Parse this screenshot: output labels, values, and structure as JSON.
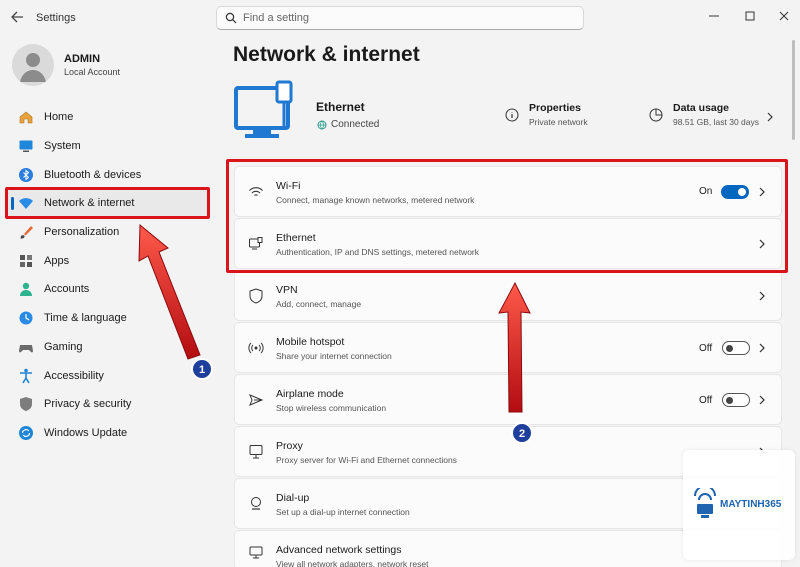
{
  "window": {
    "title": "Settings"
  },
  "search": {
    "placeholder": "Find a setting"
  },
  "user": {
    "name": "ADMIN",
    "account_type": "Local Account"
  },
  "sidebar": {
    "items": [
      {
        "label": "Home",
        "icon": "home-icon"
      },
      {
        "label": "System",
        "icon": "monitor-icon"
      },
      {
        "label": "Bluetooth & devices",
        "icon": "bluetooth-icon"
      },
      {
        "label": "Network & internet",
        "icon": "wifi-icon",
        "active": true
      },
      {
        "label": "Personalization",
        "icon": "brush-icon"
      },
      {
        "label": "Apps",
        "icon": "apps-icon"
      },
      {
        "label": "Accounts",
        "icon": "person-icon"
      },
      {
        "label": "Time & language",
        "icon": "globe-clock-icon"
      },
      {
        "label": "Gaming",
        "icon": "controller-icon"
      },
      {
        "label": "Accessibility",
        "icon": "accessibility-icon"
      },
      {
        "label": "Privacy & security",
        "icon": "shield-icon"
      },
      {
        "label": "Windows Update",
        "icon": "update-icon"
      }
    ]
  },
  "main": {
    "title": "Network & internet",
    "hero": {
      "name": "Ethernet",
      "status": "Connected",
      "properties": {
        "title": "Properties",
        "subtitle": "Private network"
      },
      "data_usage": {
        "title": "Data usage",
        "subtitle": "98.51 GB, last 30 days"
      }
    },
    "cards": [
      {
        "title": "Wi-Fi",
        "desc": "Connect, manage known networks, metered network",
        "toggle": "On",
        "icon": "wifi-icon"
      },
      {
        "title": "Ethernet",
        "desc": "Authentication, IP and DNS settings, metered network",
        "icon": "ethernet-icon"
      },
      {
        "title": "VPN",
        "desc": "Add, connect, manage",
        "icon": "vpn-shield-icon"
      },
      {
        "title": "Mobile hotspot",
        "desc": "Share your internet connection",
        "toggle": "Off",
        "icon": "hotspot-icon"
      },
      {
        "title": "Airplane mode",
        "desc": "Stop wireless communication",
        "toggle": "Off",
        "icon": "airplane-icon"
      },
      {
        "title": "Proxy",
        "desc": "Proxy server for Wi-Fi and Ethernet connections",
        "icon": "proxy-icon"
      },
      {
        "title": "Dial-up",
        "desc": "Set up a dial-up internet connection",
        "icon": "dialup-icon"
      },
      {
        "title": "Advanced network settings",
        "desc": "View all network adapters, network reset",
        "icon": "advanced-network-icon"
      }
    ]
  },
  "annotations": {
    "marker_1": "1",
    "marker_2": "2"
  },
  "watermark": {
    "brand": "MAYTINH365"
  },
  "colors": {
    "accent": "#0067c0",
    "annotation_red": "#d9141b",
    "marker_blue": "#1f3f9c"
  }
}
